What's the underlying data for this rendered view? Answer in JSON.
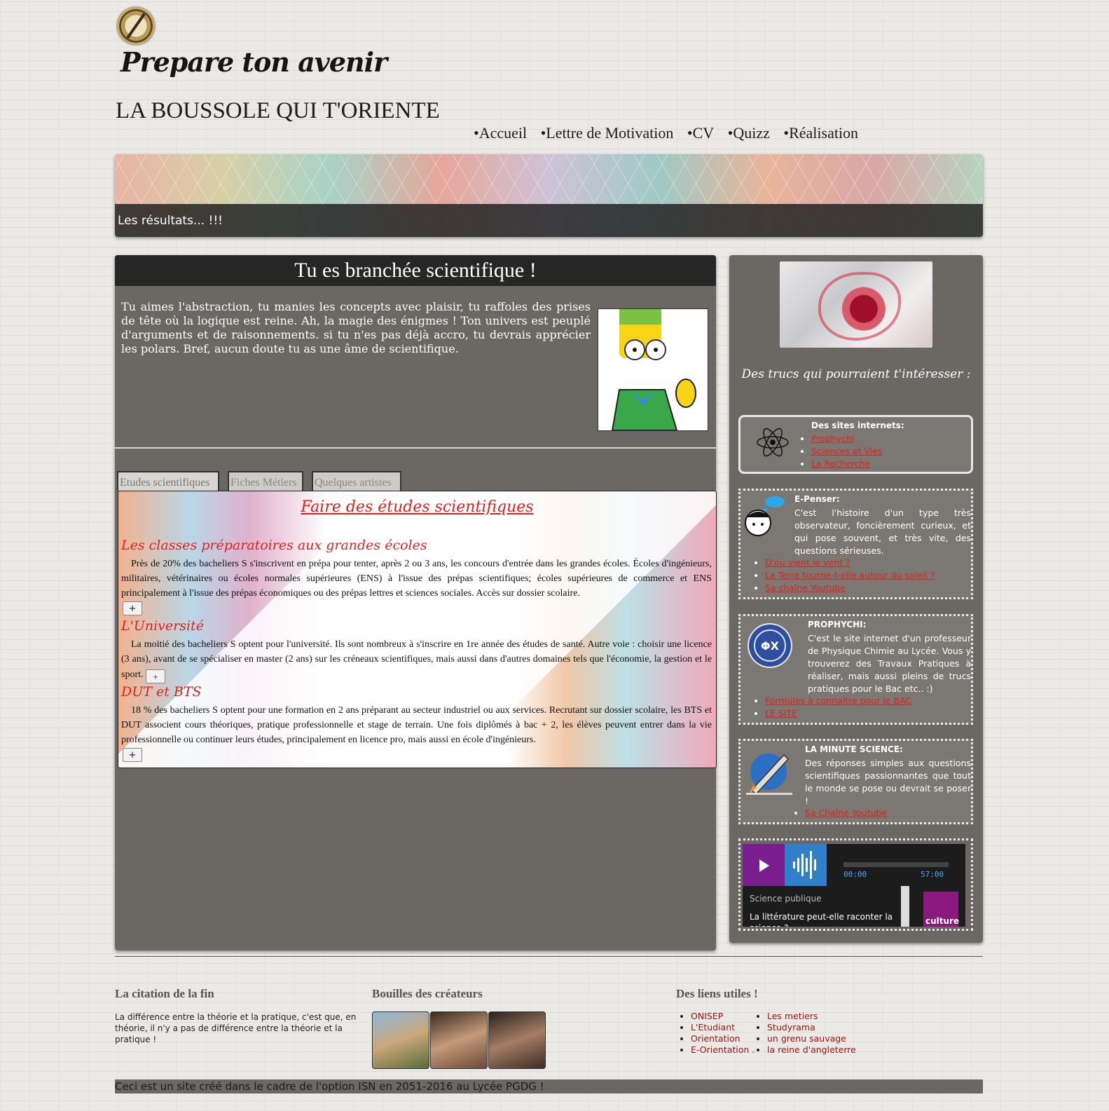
{
  "header": {
    "tagline": "Prepare ton avenir",
    "site_title": "LA BOUSSOLE QUI T'ORIENTE",
    "nav": [
      "•Accueil",
      "•Lettre de Motivation",
      "•CV",
      "•Quizz",
      "•Réalisation"
    ]
  },
  "banner": {
    "caption": "Les résultats... !!!"
  },
  "main": {
    "title": "Tu es branchée scientifique !",
    "intro": "Tu aimes l'abstraction, tu manies les concepts avec plaisir, tu raffoles des prises de tête où la logique est reine. Ah, la magie des énigmes ! Ton univers est peuplé d'arguments et de raisonnements. si tu n'es pas déjà accro, tu devrais apprécier les polars. Bref, aucun doute tu as une âme de scientifique.",
    "tabs": [
      "Etudes scientifiques",
      "Fiches Métiers",
      "Quelques artistes"
    ],
    "study_title": "Faire des études scientifiques",
    "sections": [
      {
        "title": "Les classes préparatoires aux grandes écoles",
        "body": "Près de 20% des bacheliers S s'inscrivent en prépa pour tenter, après 2 ou 3 ans, les concours d'entrée dans les grandes écoles. Écoles d'ingénieurs, militaires, vétérinaires ou écoles normales supérieures (ENS) à l'issue des prépas scientifiques; écoles supérieures de commerce et ENS principalement à l'issue des prépas économiques ou des prépas lettres et sciences sociales. Accès sur dossier scolaire."
      },
      {
        "title": "L'Université",
        "body": "La moitié des bacheliers S optent pour l'université. Ils sont nombreux à s'inscrire en 1re année des études de santé. Autre voie : choisir une licence (3 ans), avant de se spécialiser en master (2 ans) sur les créneaux scientifiques, mais aussi dans d'autres domaines tels que l'économie, la gestion et le sport."
      },
      {
        "title": "DUT et BTS",
        "body": "18 % des bacheliers S optent pour une formation en 2 ans préparant au secteur industriel ou aux services. Recrutant sur dossier scolaire, les BTS et DUT associent cours théoriques, pratique professionnelle et stage de terrain. Une fois diplômés à bac + 2, les élèves peuvent entrer dans la vie professionnelle ou continuer leurs études, principalement en licence pro, mais aussi en école d'ingénieurs."
      }
    ],
    "plus_label": "+"
  },
  "side": {
    "heading": "Des trucs qui pourraient t'intéresser :",
    "card1": {
      "title": "Des sites internets:",
      "links": [
        "Prophychi",
        "Sciences et Vies",
        "La Recherche"
      ]
    },
    "card2": {
      "title": "E-Penser:",
      "text": "C'est l'histoire d'un type très observateur, foncièrement curieux, et qui pose souvent, et très vite, des questions sérieuses.",
      "links": [
        "D'où vient le vent ?",
        "La Terre tourne-t-elle autour du soleil ?",
        "Sa chaîne Youtube"
      ]
    },
    "card3": {
      "title": "PROPHYCHI:",
      "text": "C'est le site internet d'un professeur de Physique Chimie au Lycée. Vous y trouverez des Travaux Pratiques à réaliser, mais aussi pleins de trucs pratiques pour le Bac etc.. :)",
      "links": [
        "Formules à connaître pour le BAC",
        "LE SITE"
      ]
    },
    "card4": {
      "title": "LA MINUTE SCIENCE:",
      "text": "Des réponses simples aux questions scientifiques passionnantes que tout le monde se pose ou devrait se poser !",
      "links": [
        "Sa Chaîne Youtube"
      ]
    },
    "player": {
      "time_start": "00:00",
      "time_end": "57:00",
      "show": "Science publique",
      "episode": "La littérature peut-elle raconter la science ?",
      "logo_text": "culture"
    }
  },
  "footer": {
    "quote_heading": "La citation de la fin",
    "quote": "La différence entre la théorie et la pratique, c'est que, en théorie, il n'y a pas de différence entre la théorie et la pratique !",
    "creators_heading": "Bouilles des créateurs",
    "links_heading": "Des liens utiles !",
    "links_col1": [
      "ONISEP",
      "L'Etudiant",
      "Orientation",
      "E-Orientation ."
    ],
    "links_col2": [
      "Les metiers",
      "Studyrama",
      "un grenu sauvage",
      "la reine d'angleterre"
    ],
    "bottom": "Ceci est un site créé dans le cadre de l'option ISN en 2051-2016 au Lycée PGDG !"
  }
}
